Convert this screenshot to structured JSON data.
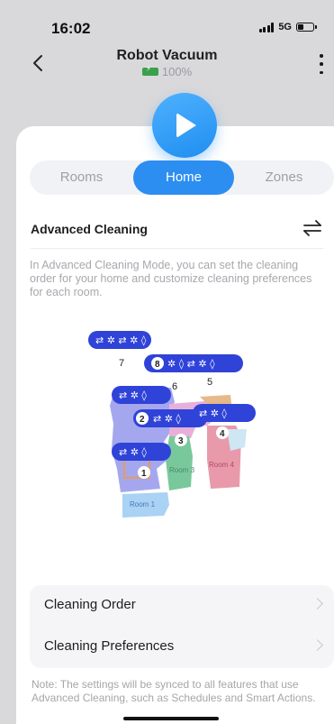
{
  "status": {
    "time": "16:02",
    "network": "5G"
  },
  "header": {
    "title": "Robot Vacuum",
    "battery": "100%"
  },
  "tabs": [
    {
      "label": "Rooms"
    },
    {
      "label": "Home"
    },
    {
      "label": "Zones"
    }
  ],
  "advanced": {
    "title": "Advanced Cleaning",
    "description": "In Advanced Cleaning Mode, you can set the cleaning order for your home and customize cleaning preferences for each room."
  },
  "map": {
    "room_numbers": [
      "1",
      "2",
      "3",
      "4",
      "5",
      "6",
      "7",
      "8"
    ],
    "room_labels": [
      "Room 1",
      "Room 3",
      "Room 4"
    ]
  },
  "list": [
    {
      "label": "Cleaning Order"
    },
    {
      "label": "Cleaning Preferences"
    }
  ],
  "note": "Note: The settings will be synced to all features that use Advanced Cleaning, such as Schedules and Smart Actions.",
  "colors": {
    "accent": "#2c8ef0",
    "battery": "#3aa04a",
    "chip": "#2f43d8"
  }
}
